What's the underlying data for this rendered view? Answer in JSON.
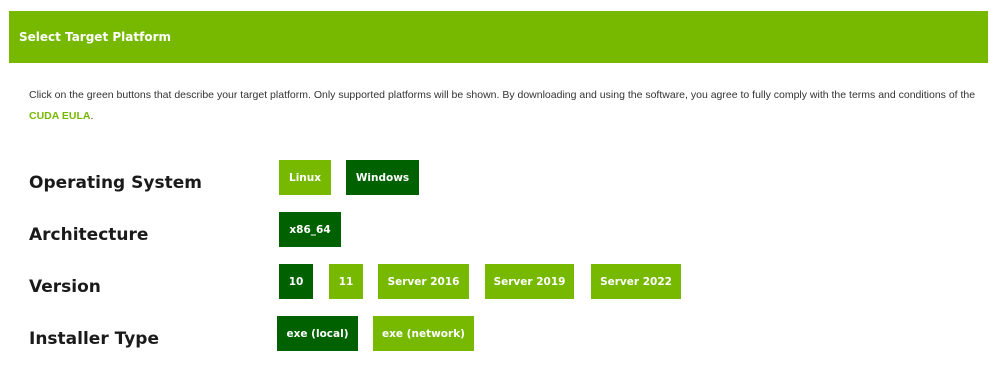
{
  "header": {
    "title": "Select Target Platform"
  },
  "intro": {
    "text_before": "Click on the green buttons that describe your target platform. Only supported platforms will be shown. By downloading and using the software, you agree to fully comply with the terms and conditions of the ",
    "eula_link": "CUDA EULA",
    "text_after": "."
  },
  "colors": {
    "accent": "#76b900",
    "selected": "#006100"
  },
  "rows": {
    "os": {
      "label": "Operating System",
      "options": [
        "Linux",
        "Windows"
      ],
      "selected": "Windows"
    },
    "arch": {
      "label": "Architecture",
      "options": [
        "x86_64"
      ],
      "selected": "x86_64"
    },
    "version": {
      "label": "Version",
      "options": [
        "10",
        "11",
        "Server 2016",
        "Server 2019",
        "Server 2022"
      ],
      "selected": "10"
    },
    "installer": {
      "label": "Installer Type",
      "options": [
        "exe (local)",
        "exe (network)"
      ],
      "selected": "exe (local)"
    }
  }
}
